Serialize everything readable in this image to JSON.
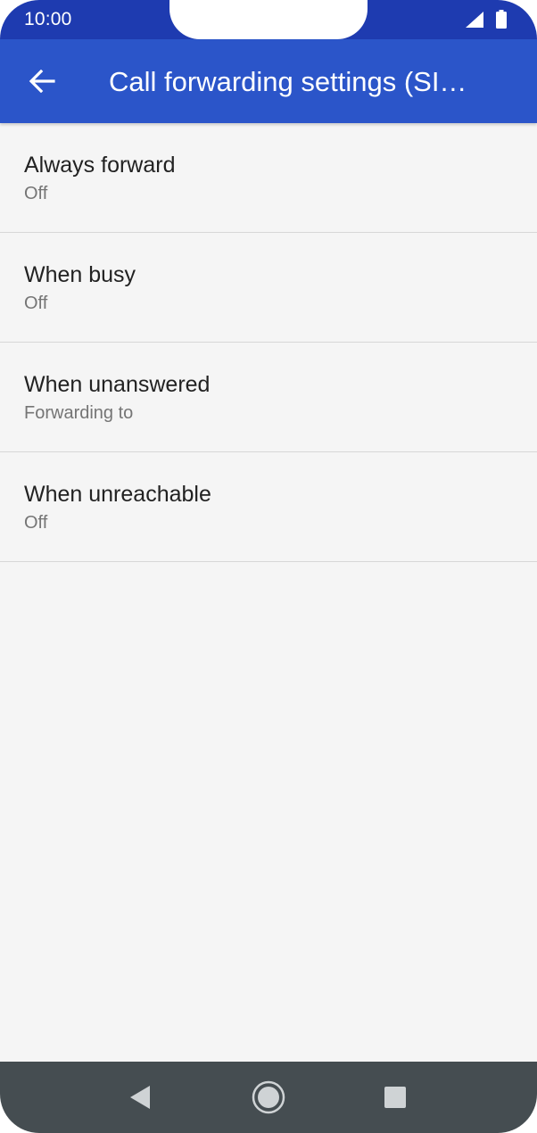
{
  "status_bar": {
    "time": "10:00"
  },
  "app_bar": {
    "title": "Call forwarding settings (SI…"
  },
  "list": {
    "items": [
      {
        "title": "Always forward",
        "summary": "Off"
      },
      {
        "title": "When busy",
        "summary": "Off"
      },
      {
        "title": "When unanswered",
        "summary": "Forwarding to"
      },
      {
        "title": "When unreachable",
        "summary": "Off"
      }
    ]
  },
  "colors": {
    "status_bar": "#1e3bb0",
    "app_bar": "#2b55c9",
    "background": "#f5f5f5",
    "nav_bar": "#454d51"
  },
  "icons": {
    "back": "arrow-left-icon",
    "signal": "cell-signal-icon",
    "battery": "battery-icon",
    "nav_back": "triangle-back-icon",
    "nav_home": "circle-home-icon",
    "nav_recents": "square-recents-icon"
  }
}
